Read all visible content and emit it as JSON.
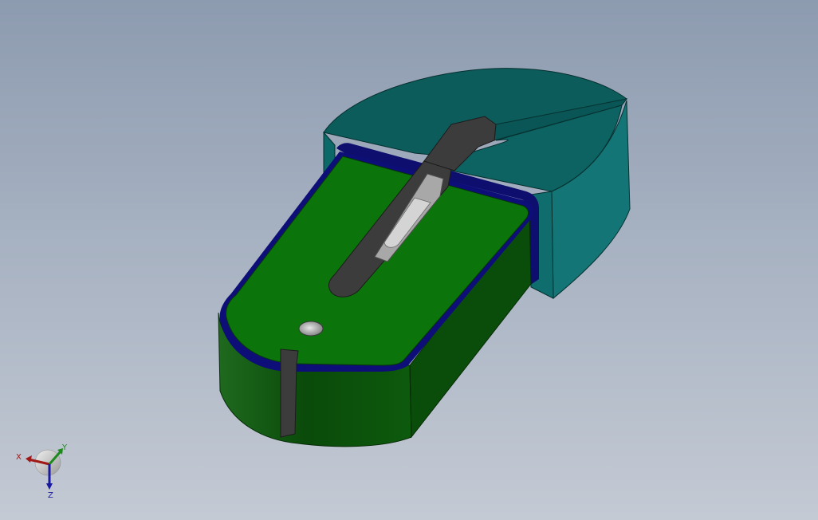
{
  "viewport": {
    "background_top": "#8d9bb0",
    "background_bottom": "#c4cad4"
  },
  "model": {
    "body_color": "#1f6f1f",
    "body_top_color": "#0e7a0e",
    "body_dark_color": "#083f08",
    "edge_color": "#0c0c6e",
    "head_color": "#0f6565",
    "head_top_color": "#0a5959",
    "slot_color": "#3c3c3c",
    "blade_color": "#b6b6b6"
  },
  "triad": {
    "x_label": "X",
    "y_label": "Y",
    "z_label": "Z",
    "x_color": "#a01818",
    "y_color": "#1e8a1e",
    "z_color": "#1a1aa0"
  }
}
